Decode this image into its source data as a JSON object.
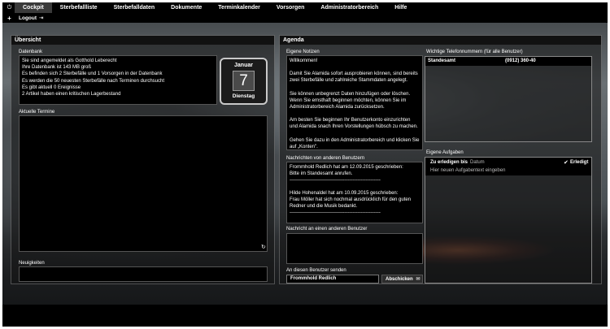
{
  "nav": {
    "items": [
      {
        "label": "Cockpit",
        "active": true
      },
      {
        "label": "Sterbefallliste"
      },
      {
        "label": "Sterbefalldaten"
      },
      {
        "label": "Dokumente"
      },
      {
        "label": "Terminkalender"
      },
      {
        "label": "Vorsorgen"
      },
      {
        "label": "Administratorbereich"
      },
      {
        "label": "Hilfe"
      }
    ],
    "logout_label": "Logout"
  },
  "uebersicht": {
    "title": "Übersicht",
    "datenbank_label": "Datenbank",
    "datenbank_lines": [
      "Sie sind angemeldet als Gotthold Leberecht",
      "Ihre Datenbank ist 143 MB  groß",
      "Es befinden sich 2 Sterbefälle und 1 Vorsorgen in der Datenbank",
      "Es werden die 50 neuesten Sterbefälle nach Terminen durchsucht",
      "Es gibt aktuell 0 Ereignisse",
      "2 Artikel haben einen kritischen Lagerbestand"
    ],
    "calendar": {
      "month": "Januar",
      "day": "7",
      "weekday": "Dienstag"
    },
    "termine_label": "Aktuelle Termine",
    "neuigkeiten_label": "Neuigkeiten"
  },
  "agenda": {
    "title": "Agenda",
    "notizen_label": "Eigene Notizen",
    "notizen_paragraphs": [
      "Willkommen!",
      "Damit Sie Alamida sofort ausprobieren können, sind bereits zwei Sterbefälle und zahlreiche Stammdaten angelegt.",
      "Sie können unbegrenzt Daten hinzufügen oder löschen. Wenn Sie ernsthaft beginnen möchten, können Sie im Administratorbereich Alamida zurücksetzen.",
      "Am besten Sie beginnen Ihr Benutzerkonto einzurichten und Alamida snach Ihren Vorstellungen hübsch zu machen.",
      "Gehen Sie dazu in den Administratorbereich und klicken Sie auf „Konten\"."
    ],
    "nachrichten_label": "Nachrichten von anderen Benutzern",
    "nachrichten": [
      {
        "head": "Frommhold Redlich hat am 12.09.2015 geschrieben:",
        "body": "Bitte im Standesamt anrufen.",
        "sep": "--------------------------------------------------------"
      },
      {
        "head": "Hilde Hohenaldel hat am 10.09.2015 geschrieben:",
        "body": "Frau Möller hat sich nochmal ausdrücklich für den guten Redner und die Musik bedankt.",
        "sep": "--------------------------------------------------------"
      }
    ],
    "nachricht_an_label": "Nachricht an einen anderen Benutzer",
    "senden_label": "An diesen Benutzer senden",
    "recipient_value": "Frommhold Redlich",
    "send_button": "Abschicken",
    "telefon_label": "Wichtige Telefonnummern (für alle Benutzer)",
    "telefon": [
      {
        "name": "Standesamt",
        "number": "(0912) 360-40"
      }
    ],
    "aufgaben_label": "Eigene Aufgaben",
    "aufgaben_col_due": "Zu erledigen bis",
    "aufgaben_col_date": "Datum",
    "aufgaben_col_done": "Erledigt",
    "aufgaben_placeholder": "Hier neuen Aufgabentext eingeben"
  }
}
